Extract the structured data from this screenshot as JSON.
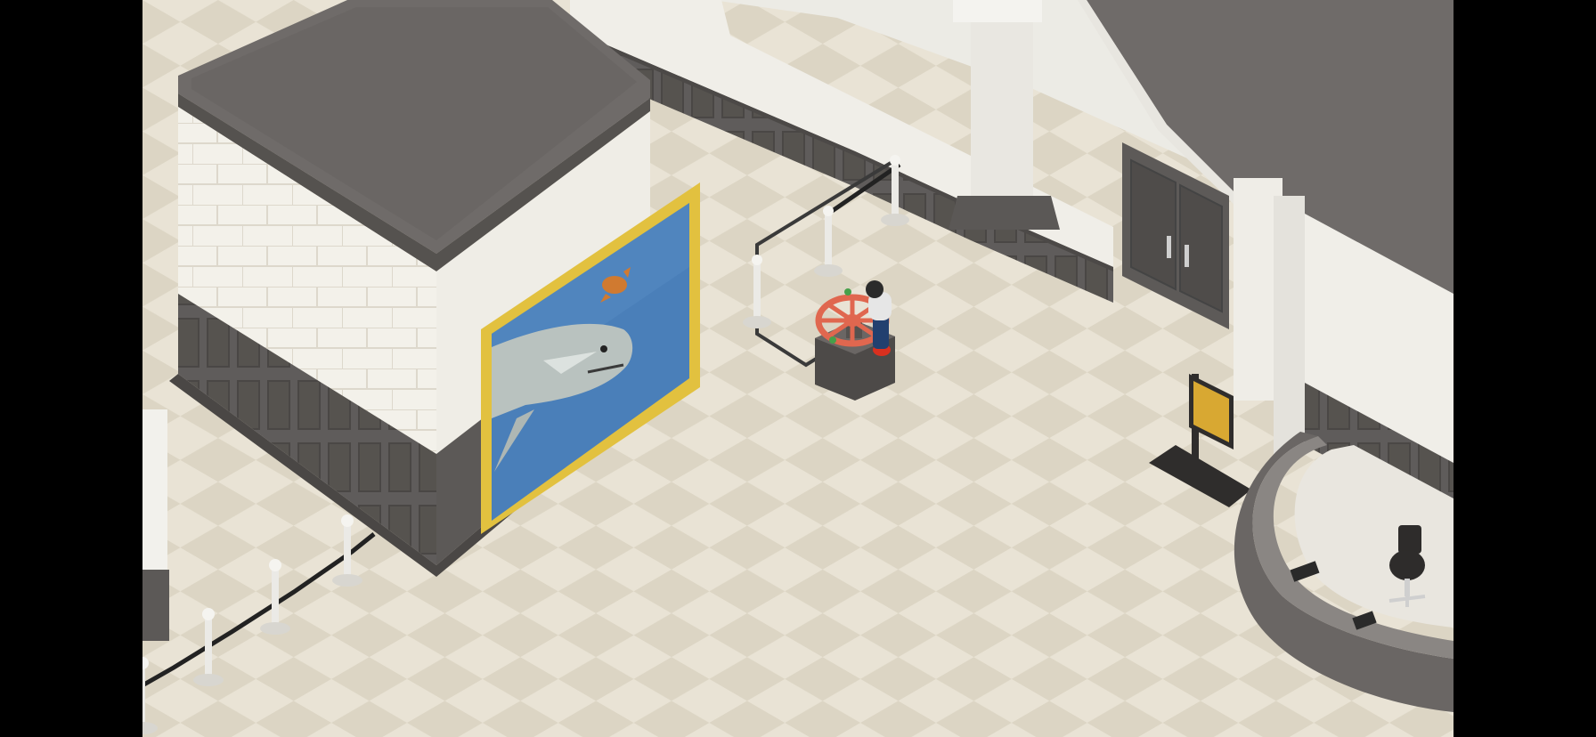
{
  "scene": {
    "setting": "museum-lobby",
    "view": "isometric",
    "objects": [
      {
        "name": "shark-painting",
        "subject": "shark"
      },
      {
        "name": "ships-wheel-exhibit"
      },
      {
        "name": "visitor-character"
      },
      {
        "name": "info-sign"
      },
      {
        "name": "reception-desk"
      },
      {
        "name": "office-chair"
      },
      {
        "name": "double-doors"
      }
    ]
  },
  "colors": {
    "floor_light": "#e9e3d5",
    "floor_dark": "#dcd5c4",
    "wall_white": "#f2f0ea",
    "wainscot": "#5f5c5b",
    "roof": "#6f6b69",
    "frame_gold": "#e2c13f",
    "painting_blue": "#4a7fb9",
    "wheel_red": "#e0674f",
    "sign_gold": "#d8a832"
  }
}
